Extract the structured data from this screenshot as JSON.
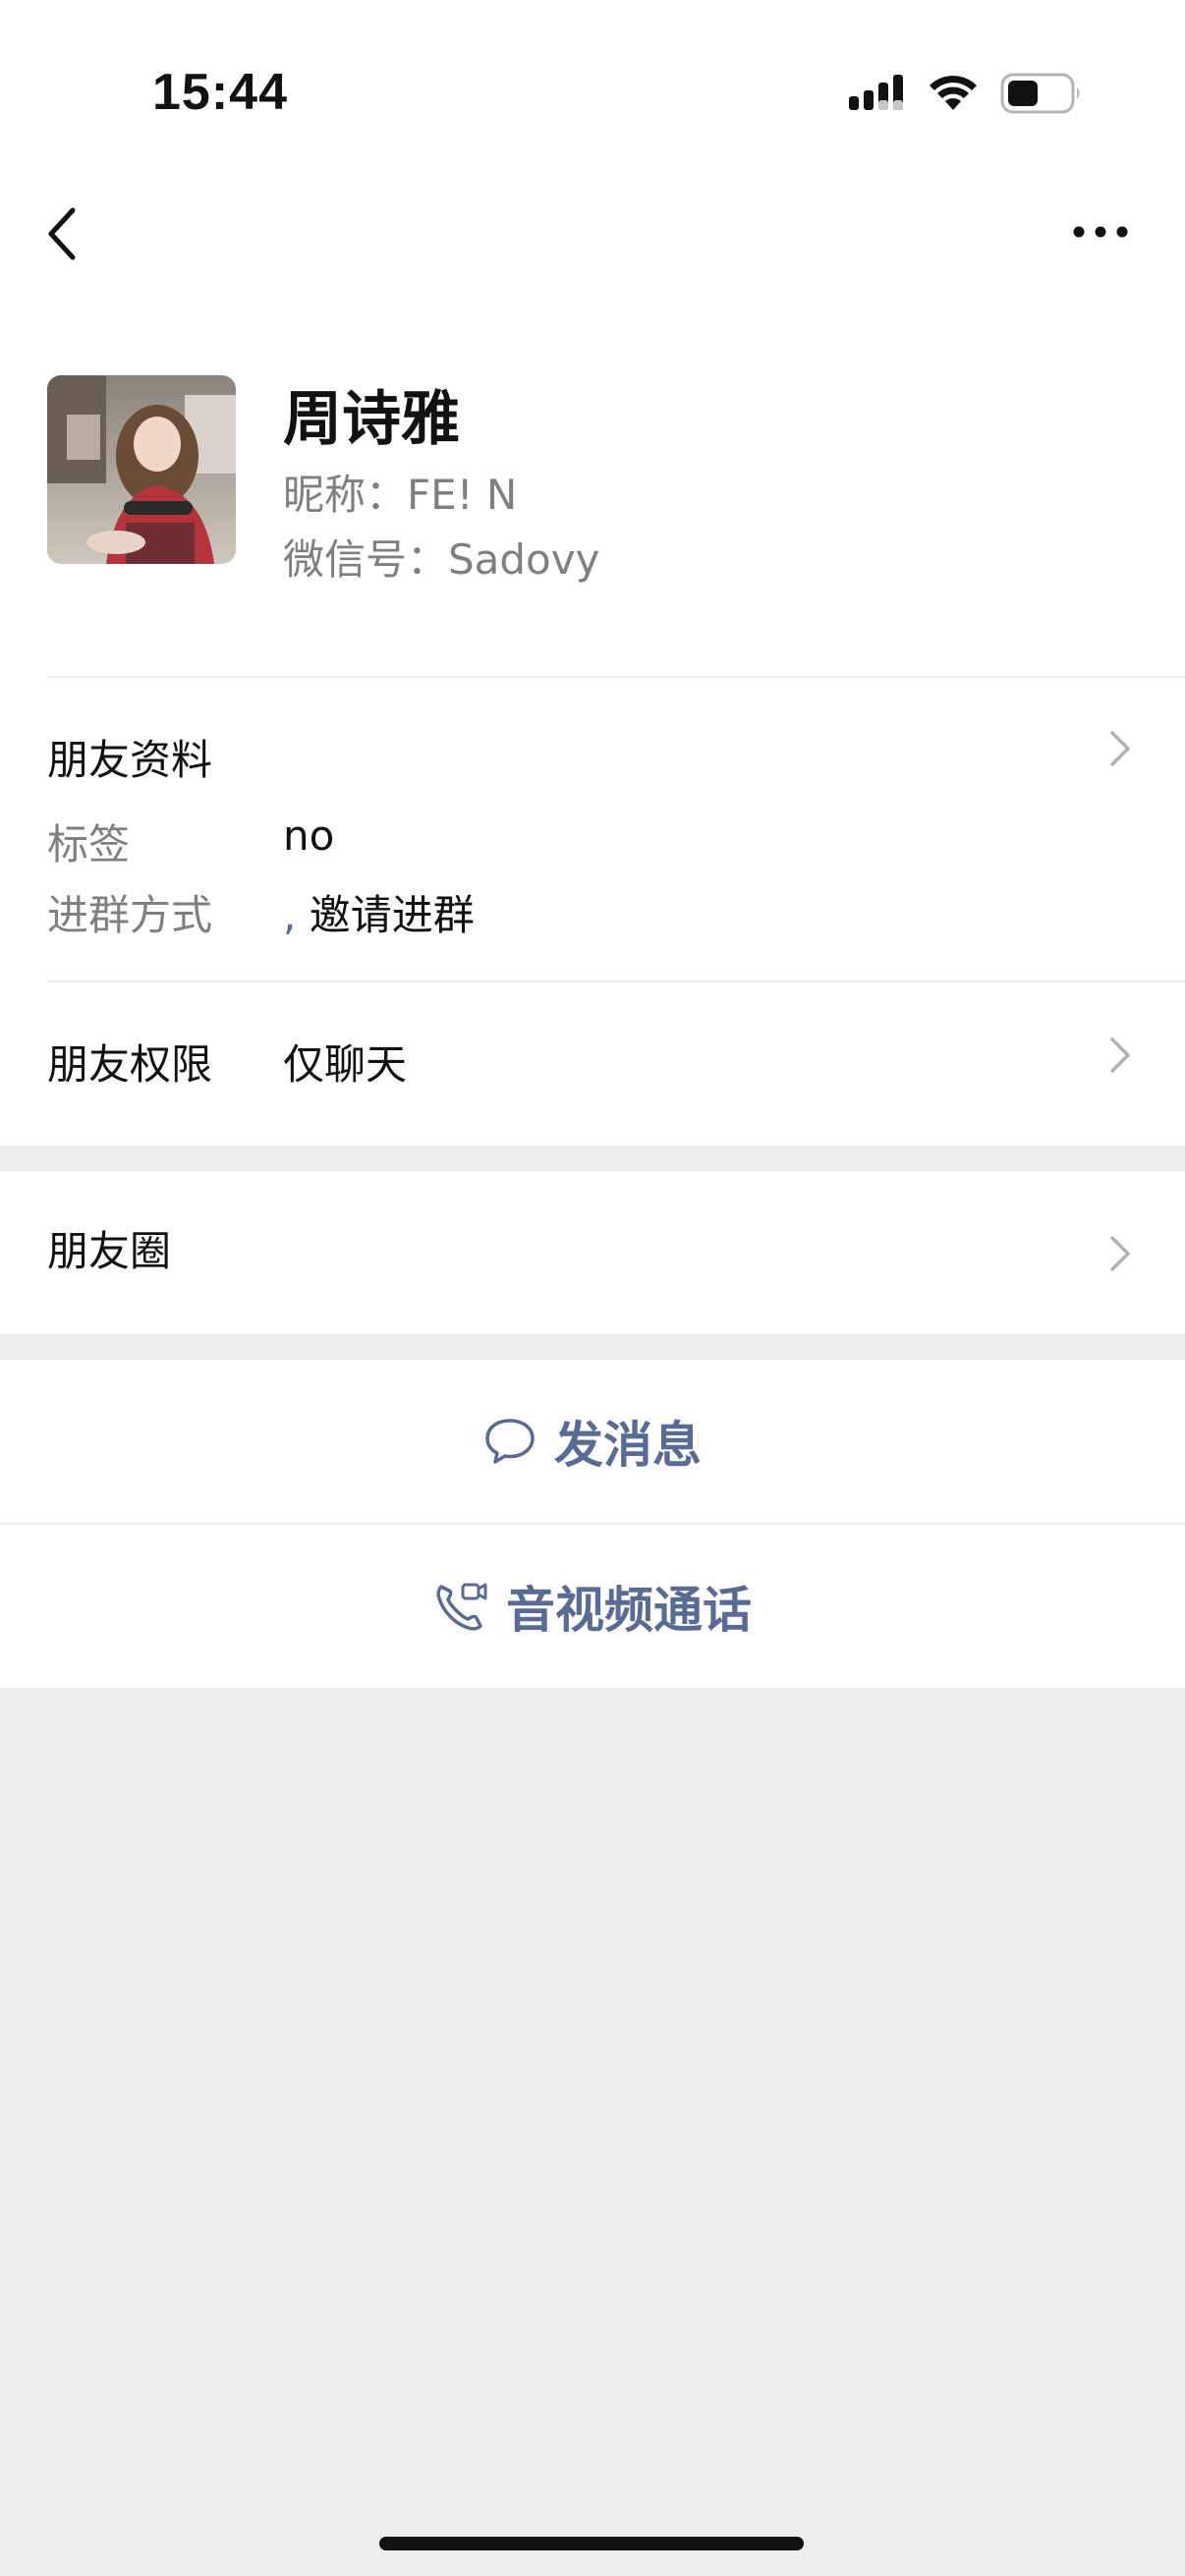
{
  "status_bar": {
    "time": "15:44"
  },
  "profile": {
    "name": "周诗雅",
    "nickname_line": "昵称：FE! N",
    "wechat_id_line": "微信号：Sadovy"
  },
  "friend_info": {
    "title": "朋友资料",
    "tag_label": "标签",
    "tag_value": "no",
    "join_label": "进群方式",
    "join_comma": ",",
    "join_value": "邀请进群"
  },
  "permissions": {
    "label": "朋友权限",
    "value": "仅聊天"
  },
  "moments": {
    "label": "朋友圈"
  },
  "actions": {
    "send_message": "发消息",
    "av_call": "音视频通话"
  },
  "colors": {
    "accent": "#576b95",
    "background": "#ededed"
  }
}
